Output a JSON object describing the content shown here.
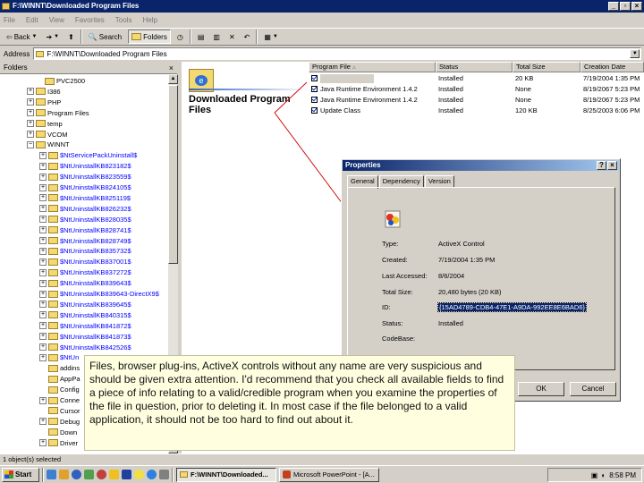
{
  "window": {
    "title": "F:\\WINNT\\Downloaded Program Files"
  },
  "menu": [
    "File",
    "Edit",
    "View",
    "Favorites",
    "Tools",
    "Help"
  ],
  "toolbar": {
    "back": "Back",
    "search": "Search",
    "folders": "Folders"
  },
  "address": {
    "label": "Address",
    "value": "F:\\WINNT\\Downloaded Program Files"
  },
  "folders_pane": {
    "header": "Folders",
    "close": "×",
    "items": [
      {
        "label": "PVC2500",
        "expander": "",
        "blue": false
      },
      {
        "label": "I386",
        "expander": "+",
        "blue": false
      },
      {
        "label": "PHP",
        "expander": "+",
        "blue": false
      },
      {
        "label": "Program Files",
        "expander": "+",
        "blue": false
      },
      {
        "label": "temp",
        "expander": "+",
        "blue": false
      },
      {
        "label": "VCOM",
        "expander": "+",
        "blue": false
      },
      {
        "label": "WINNT",
        "expander": "−",
        "blue": false
      },
      {
        "label": "$NtServicePackUninstall$",
        "expander": "+",
        "blue": true
      },
      {
        "label": "$NtUninstallKB823182$",
        "expander": "+",
        "blue": true
      },
      {
        "label": "$NtUninstallKB823559$",
        "expander": "+",
        "blue": true
      },
      {
        "label": "$NtUninstallKB824105$",
        "expander": "+",
        "blue": true
      },
      {
        "label": "$NtUninstallKB825119$",
        "expander": "+",
        "blue": true
      },
      {
        "label": "$NtUninstallKB826232$",
        "expander": "+",
        "blue": true
      },
      {
        "label": "$NtUninstallKB828035$",
        "expander": "+",
        "blue": true
      },
      {
        "label": "$NtUninstallKB828741$",
        "expander": "+",
        "blue": true
      },
      {
        "label": "$NtUninstallKB828749$",
        "expander": "+",
        "blue": true
      },
      {
        "label": "$NtUninstallKB835732$",
        "expander": "+",
        "blue": true
      },
      {
        "label": "$NtUninstallKB837001$",
        "expander": "+",
        "blue": true
      },
      {
        "label": "$NtUninstallKB837272$",
        "expander": "+",
        "blue": true
      },
      {
        "label": "$NtUninstallKB839643$",
        "expander": "+",
        "blue": true
      },
      {
        "label": "$NtUninstallKB839643-DirectX9$",
        "expander": "+",
        "blue": true
      },
      {
        "label": "$NtUninstallKB839645$",
        "expander": "+",
        "blue": true
      },
      {
        "label": "$NtUninstallKB840315$",
        "expander": "+",
        "blue": true
      },
      {
        "label": "$NtUninstallKB841872$",
        "expander": "+",
        "blue": true
      },
      {
        "label": "$NtUninstallKB841873$",
        "expander": "+",
        "blue": true
      },
      {
        "label": "$NtUninstallKB842526$",
        "expander": "+",
        "blue": true
      },
      {
        "label": "$NtUn",
        "expander": "+",
        "blue": true
      },
      {
        "label": "addins",
        "expander": "",
        "blue": false
      },
      {
        "label": "AppPa",
        "expander": "",
        "blue": false
      },
      {
        "label": "Config",
        "expander": "",
        "blue": false
      },
      {
        "label": "Conne",
        "expander": "+",
        "blue": false
      },
      {
        "label": "Cursor",
        "expander": "",
        "blue": false
      },
      {
        "label": "Debug",
        "expander": "+",
        "blue": false
      },
      {
        "label": "Down",
        "expander": "",
        "blue": false
      },
      {
        "label": "Driver",
        "expander": "+",
        "blue": false
      }
    ]
  },
  "webview": {
    "title": "Downloaded Program Files"
  },
  "columns": [
    "Program File",
    "Status",
    "Total Size",
    "Creation Date"
  ],
  "files": [
    {
      "name": "",
      "status": "Installed",
      "size": "20 KB",
      "date": "7/19/2004 1:35 PM"
    },
    {
      "name": "Java Runtime Environment 1.4.2",
      "status": "Installed",
      "size": "None",
      "date": "8/19/2067 5:23 PM"
    },
    {
      "name": "Java Runtime Environment 1.4.2",
      "status": "Installed",
      "size": "None",
      "date": "8/19/2067 5:23 PM"
    },
    {
      "name": "Update Class",
      "status": "Installed",
      "size": "120 KB",
      "date": "8/25/2003 6:06 PM"
    }
  ],
  "dialog": {
    "title": "Properties",
    "help": "?",
    "close": "×",
    "tabs": [
      "General",
      "Dependency",
      "Version"
    ],
    "fields": [
      {
        "label": "Type:",
        "value": "ActiveX Control"
      },
      {
        "label": "Created:",
        "value": "7/19/2004 1:35 PM"
      },
      {
        "label": "Last Accessed:",
        "value": "8/6/2004"
      },
      {
        "label": "Total Size:",
        "value": "20,480 bytes  (20 KB)"
      },
      {
        "label": "ID:",
        "value": "{15AD4789-CDB4-47E1-A9DA-992EE8E6BAD6}"
      },
      {
        "label": "Status:",
        "value": "Installed"
      },
      {
        "label": "CodeBase:",
        "value": ""
      }
    ],
    "ok": "OK",
    "cancel": "Cancel"
  },
  "callout": "Files, browser plug-ins, ActiveX controls without any name are very suspicious and should be given extra attention. I'd recommend that you check all available fields to find a piece of info relating to a valid/credible program when you examine the properties of the file in question, prior to deleting it. In most case if the file belonged to a valid application, it should not be too hard to find out about it.",
  "status": "1 object(s) selected",
  "taskbar": {
    "start": "Start",
    "tasks": [
      "F:\\WINNT\\Downloaded...",
      "Microsoft PowerPoint - [A..."
    ],
    "clock": "8:58 PM"
  }
}
